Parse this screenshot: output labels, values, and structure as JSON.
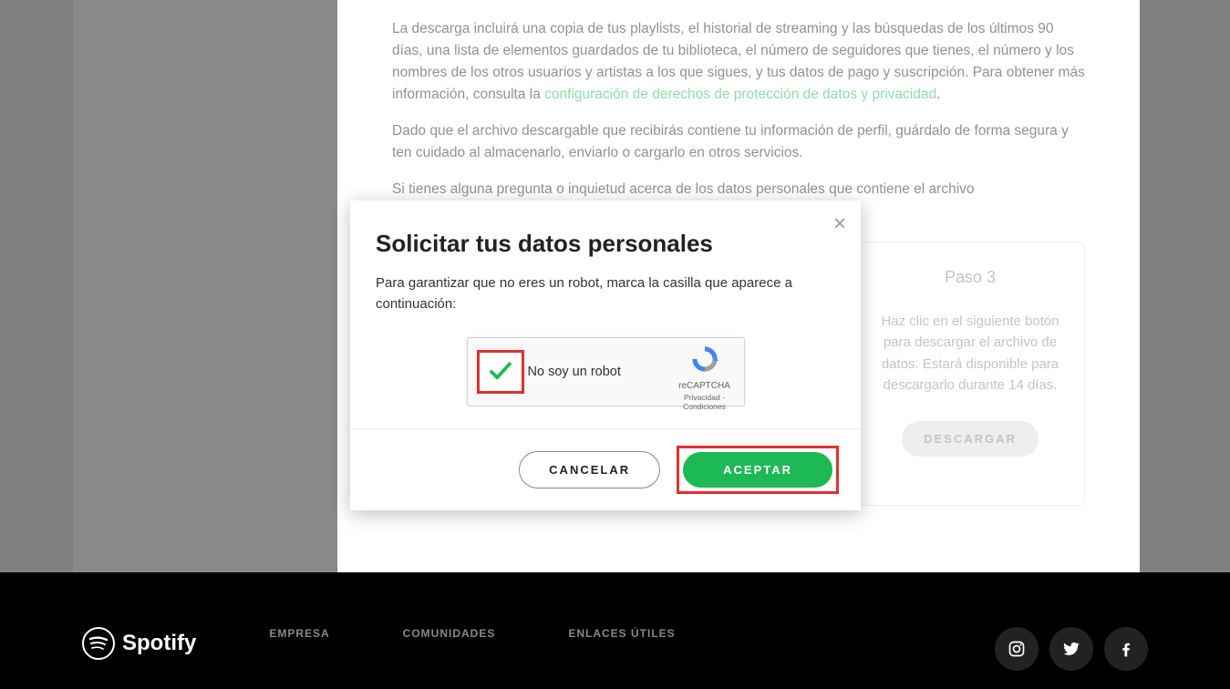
{
  "main": {
    "para1_part1": "La descarga incluirá una copia de tus playlists, el historial de streaming y las búsquedas de los últimos 90 días, una lista de elementos guardados de tu biblioteca, el número de seguidores que tienes, el número y los nombres de los otros usuarios y artistas a los que sigues, y tus datos de pago y suscripción. Para obtener más información, consulta la ",
    "para1_link": "configuración de derechos de protección de datos y privacidad",
    "para1_end": ".",
    "para2": "Dado que el archivo descargable que recibirás contiene tu información de perfil, guárdalo de forma segura y ten cuidado al almacenarlo, enviarlo o cargarlo en otros servicios.",
    "para3": "Si tienes alguna pregunta o inquietud acerca de los datos personales que contiene el archivo"
  },
  "step": {
    "title": "Paso 3",
    "body": "Haz clic en el siguiente botón para descargar el archivo de datos. Estará disponible para descargarlo durante 14 días.",
    "button": "DESCARGAR"
  },
  "modal": {
    "title": "Solicitar tus datos personales",
    "text": "Para garantizar que no eres un robot, marca la casilla que aparece a continuación:",
    "recaptcha_label": "No soy un robot",
    "recaptcha_brand": "reCAPTCHA",
    "recaptcha_terms": "Privacidad - Condiciones",
    "cancel": "CANCELAR",
    "accept": "ACEPTAR"
  },
  "footer": {
    "brand": "Spotify",
    "col1": "EMPRESA",
    "col2": "COMUNIDADES",
    "col3": "ENLACES ÚTILES"
  }
}
